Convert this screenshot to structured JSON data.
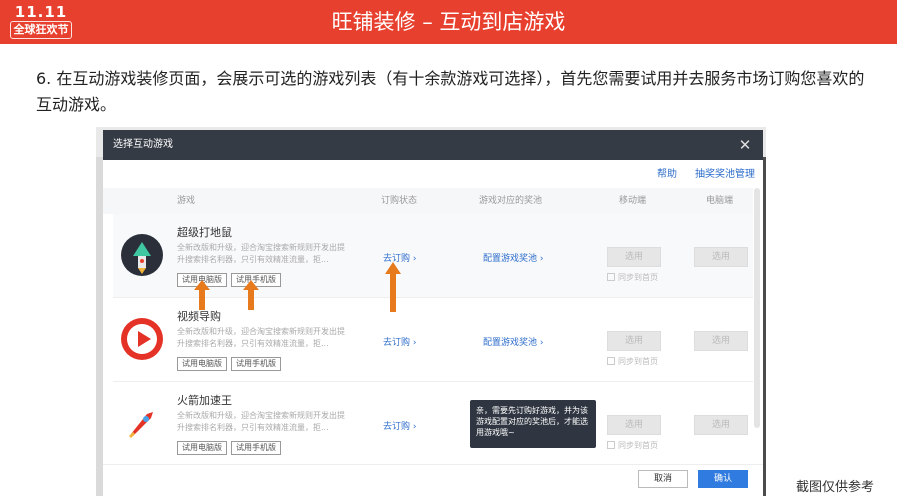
{
  "header": {
    "logo_top": "11.11",
    "logo_bottom": "全球狂欢节",
    "title": "旺铺装修 – 互动到店游戏"
  },
  "instruction": "6. 在互动游戏装修页面，会展示可选的游戏列表（有十余款游戏可选择），首先您需要试用并去服务市场订购您喜欢的互动游戏。",
  "dialog": {
    "title": "选择互动游戏",
    "links": [
      "帮助",
      "抽奖奖池管理"
    ],
    "columns": [
      "游戏",
      "订购状态",
      "游戏对应的奖池",
      "移动端",
      "电脑端"
    ],
    "games": [
      {
        "name": "超级打地鼠",
        "desc": "全新改版和升级，迎合淘宝搜索新规则开发出提升搜索排名利器，只引有效精准流量，拒...",
        "try_pc": "试用电脑版",
        "try_mobile": "试用手机版",
        "subscribe": "去订购 ›",
        "config": "配置游戏奖池 ›",
        "use_mobile": "选用",
        "use_pc": "选用",
        "sync": "同步到首页"
      },
      {
        "name": "视频导购",
        "desc": "全新改版和升级，迎合淘宝搜索新规则开发出提升搜索排名利器，只引有效精准流量，拒...",
        "try_pc": "试用电脑版",
        "try_mobile": "试用手机版",
        "subscribe": "去订购 ›",
        "config": "配置游戏奖池 ›",
        "use_mobile": "选用",
        "use_pc": "选用",
        "sync": "同步到首页"
      },
      {
        "name": "火箭加速王",
        "desc": "全新改版和升级，迎合淘宝搜索新规则开发出提升搜索排名利器，只引有效精准流量，拒...",
        "try_pc": "试用电脑版",
        "try_mobile": "试用手机版",
        "subscribe": "去订购 ›",
        "use_mobile": "选用",
        "use_pc": "选用",
        "sync": "同步到首页"
      }
    ],
    "tooltip": "亲，需要先订购好游戏，并为该游戏配置对应的奖池后，才能选用游戏哦~",
    "cancel": "取消",
    "confirm": "确认"
  },
  "caption": "截图仅供参考",
  "colors": {
    "header_red": "#e8402e",
    "link_blue": "#2f6ecb",
    "arrow_orange": "#e87a1e",
    "primary_blue": "#2f7bdf"
  }
}
